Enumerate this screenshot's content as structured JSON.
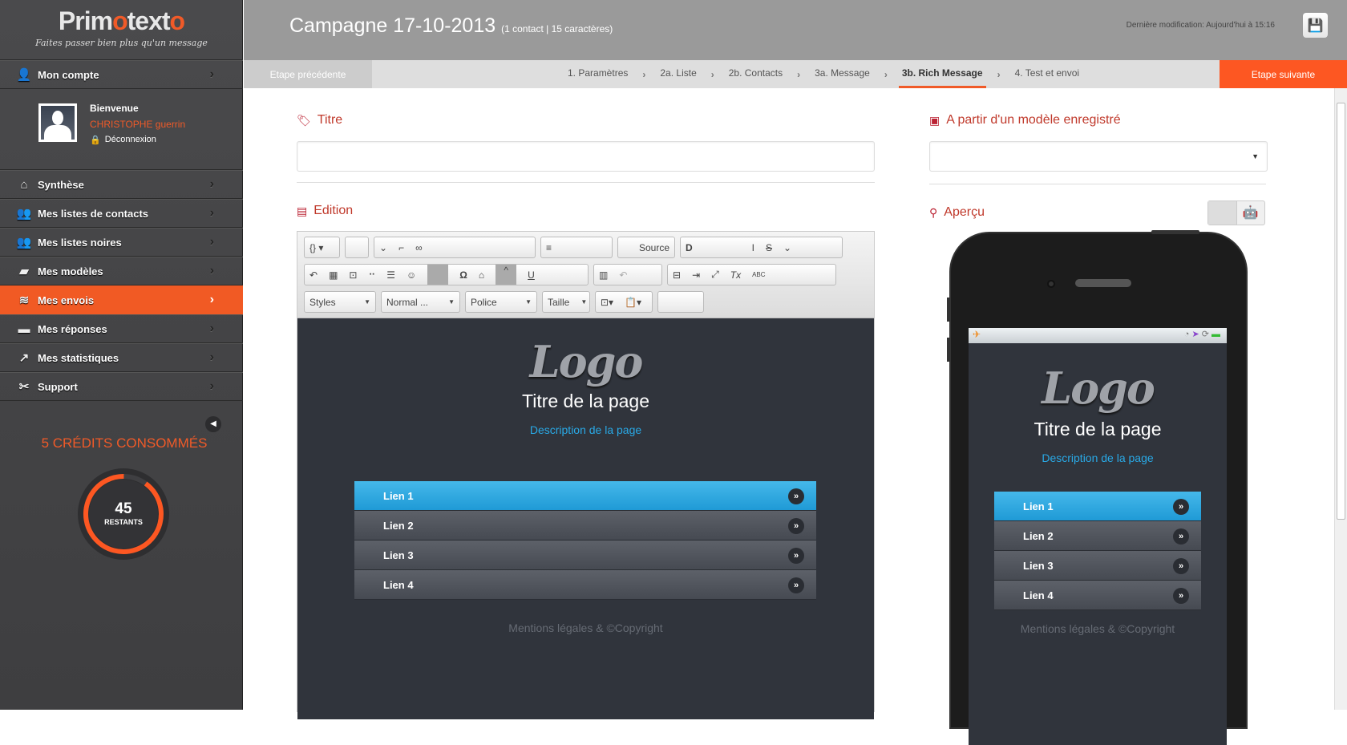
{
  "brand": {
    "name_a": "Prim",
    "name_b": "o",
    "name_c": "text",
    "name_d": "o",
    "tagline": "Faites passer bien plus qu'un message"
  },
  "sidebar": {
    "account": {
      "label": "Mon compte",
      "icon": "user-icon"
    },
    "user": {
      "welcome": "Bienvenue",
      "name": "CHRISTOPHE guerrin",
      "logout": "Déconnexion"
    },
    "items": [
      {
        "label": "Synthèse",
        "icon": "home-icon"
      },
      {
        "label": "Mes listes de contacts",
        "icon": "users-icon"
      },
      {
        "label": "Mes listes noires",
        "icon": "users-block-icon"
      },
      {
        "label": "Mes modèles",
        "icon": "folder-icon"
      },
      {
        "label": "Mes envois",
        "icon": "wifi-icon",
        "active": true
      },
      {
        "label": "Mes réponses",
        "icon": "comment-icon"
      },
      {
        "label": "Mes statistiques",
        "icon": "chart-icon"
      },
      {
        "label": "Support",
        "icon": "tools-icon"
      }
    ],
    "credits": {
      "consumed_label": "5 CRÉDITS CONSOMMÉS",
      "remaining": "45",
      "remaining_label": "RESTANTS",
      "remaining_fraction": 0.9
    }
  },
  "header": {
    "title": "Campagne 17-10-2013",
    "subtitle": "(1 contact | 15 caractères)",
    "last_modified": "Dernière modification: Aujourd'hui à 15:16"
  },
  "steps": {
    "prev": "Etape précédente",
    "next": "Etape suivante",
    "items": [
      "1. Paramètres",
      "2a. Liste",
      "2b. Contacts",
      "3a. Message",
      "3b. Rich Message",
      "4. Test et envoi"
    ],
    "current": 4
  },
  "form": {
    "title_label": "Titre",
    "title_value": "",
    "edition_label": "Edition",
    "model_label": "A partir d'un modèle enregistré",
    "model_value": "",
    "preview_label": "Aperçu"
  },
  "toolbar": {
    "source": "Source",
    "styles": "Styles",
    "format": "Normal ...",
    "font": "Police",
    "size": "Taille"
  },
  "content": {
    "logo": "Logo",
    "page_title": "Titre de la page",
    "page_desc": "Description de la page",
    "links": [
      "Lien 1",
      "Lien 2",
      "Lien 3",
      "Lien 4"
    ],
    "footer": "Mentions légales & ©Copyright"
  },
  "colors": {
    "accent": "#f15a24",
    "link_active": "#29a9e6",
    "canvas": "#30343c"
  }
}
